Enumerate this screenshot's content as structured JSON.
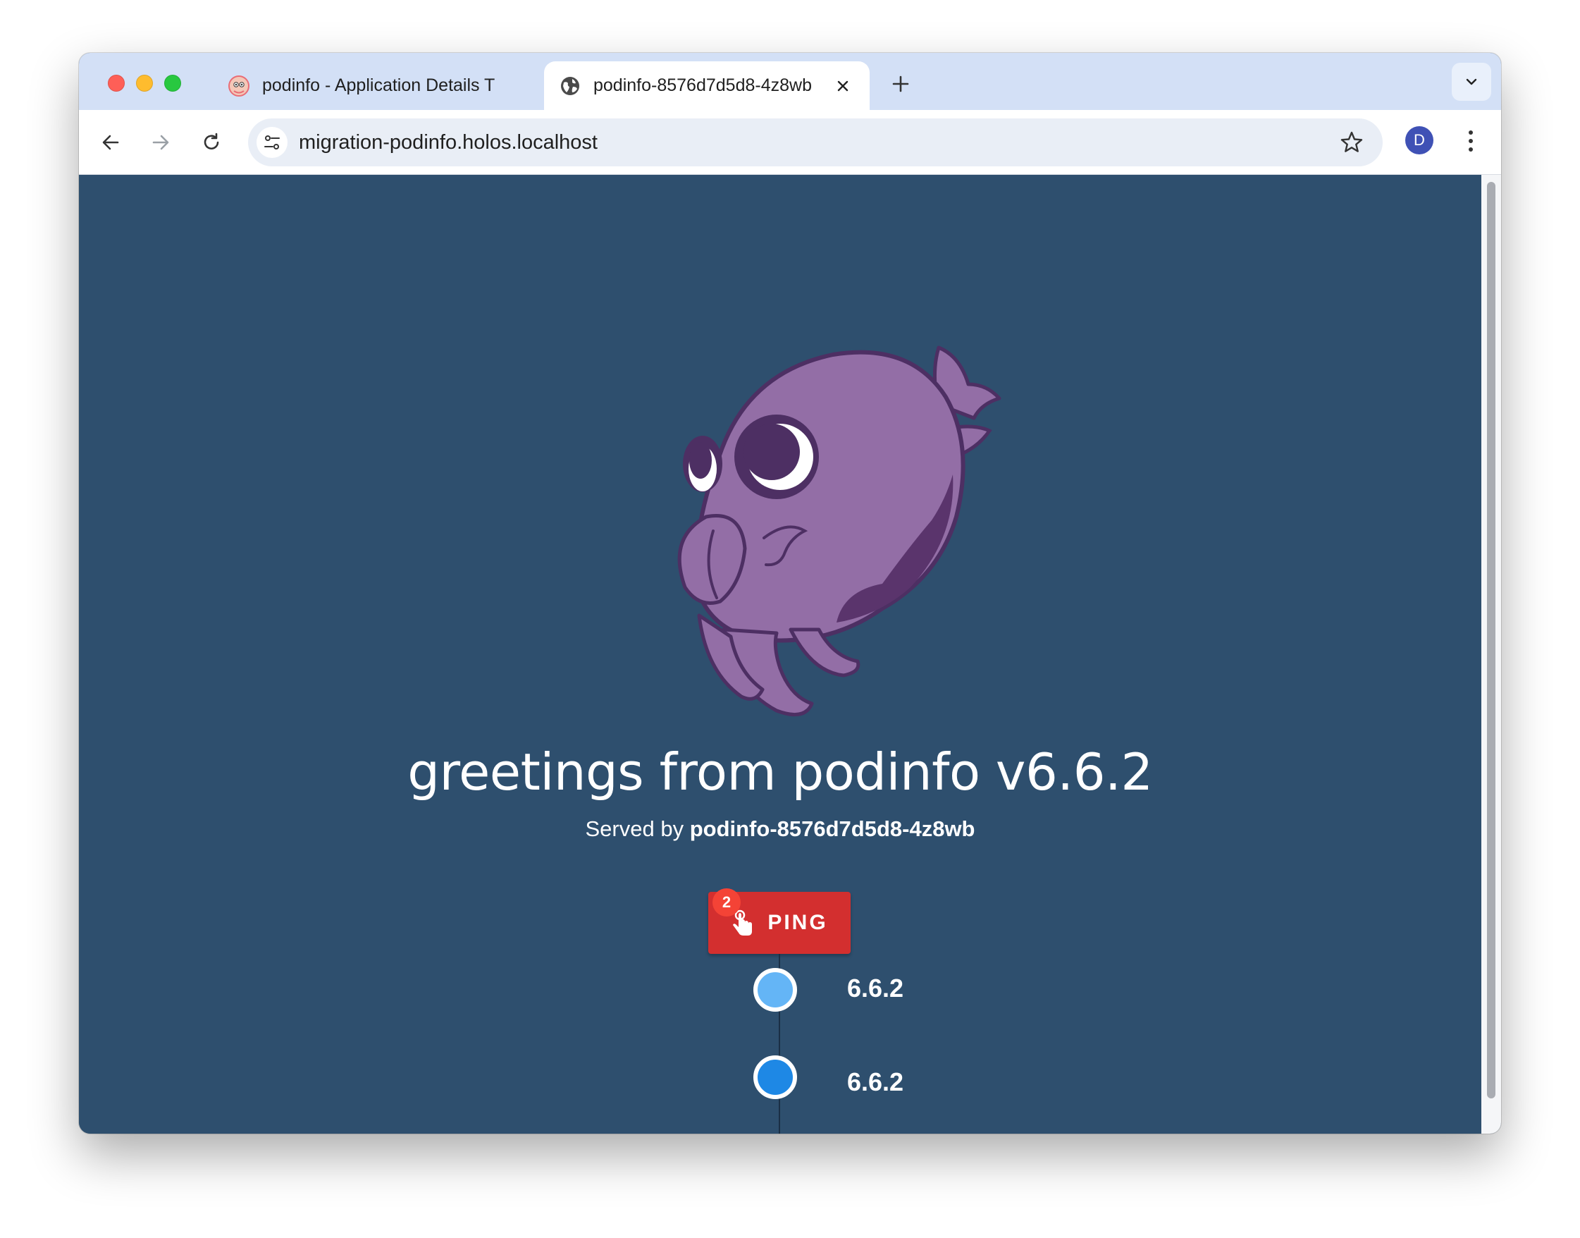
{
  "browser": {
    "tabs": [
      {
        "title": "podinfo - Application Details T",
        "favicon": "argo-icon",
        "active": false
      },
      {
        "title": "podinfo-8576d7d5d8-4z8wb",
        "favicon": "globe-icon",
        "active": true
      }
    ],
    "address": "migration-podinfo.holos.localhost",
    "profile_initial": "D"
  },
  "page": {
    "greeting": "greetings from podinfo v6.6.2",
    "served_prefix": "Served by ",
    "served_host": "podinfo-8576d7d5d8-4z8wb",
    "ping_label": "PING",
    "ping_count": "2",
    "timeline": [
      {
        "version": "6.6.2",
        "color": "#64b5f6"
      },
      {
        "version": "6.6.2",
        "color": "#1e88e5"
      }
    ]
  },
  "colors": {
    "page_background": "#2e4f6e",
    "ping_button": "#d32f2f",
    "badge": "#f44336",
    "mascot_body": "#936ea6",
    "mascot_outline": "#4d2f63"
  }
}
